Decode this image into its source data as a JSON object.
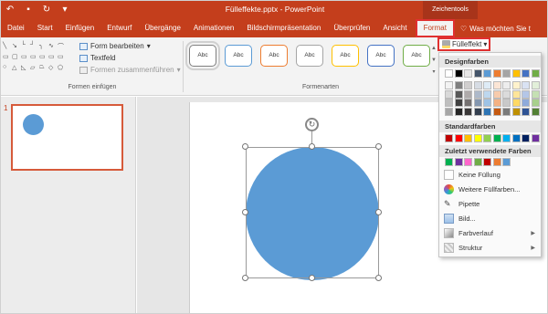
{
  "titlebar": {
    "doc_title": "Fülleffekte.pptx - PowerPoint",
    "context_label": "Zeichentools",
    "qat_icons": [
      "undo-icon",
      "save-icon",
      "refresh-icon",
      "customize-icon"
    ]
  },
  "tabs": [
    "Datei",
    "Start",
    "Einfügen",
    "Entwurf",
    "Übergänge",
    "Animationen",
    "Bildschirmpräsentation",
    "Überprüfen",
    "Ansicht",
    "Format"
  ],
  "tell_me": "Was möchten Sie t",
  "ribbon": {
    "edit_shape": "Form bearbeiten",
    "textbox": "Textfeld",
    "merge_shapes": "Formen zusammenführen",
    "group_insert_label": "Formen einfügen",
    "group_styles_label": "Formenarten",
    "style_label": "Abc",
    "style_colors": [
      "#7f7f7f",
      "#5b9bd5",
      "#ed7d31",
      "#a5a5a5",
      "#ffc000",
      "#4472c4",
      "#70ad47"
    ]
  },
  "fill_button": "Fülleffekt",
  "dropdown": {
    "theme_header": "Designfarben",
    "standard_header": "Standardfarben",
    "recent_header": "Zuletzt verwendete Farben",
    "theme_top": [
      "#ffffff",
      "#000000",
      "#e7e6e6",
      "#44546a",
      "#5b9bd5",
      "#ed7d31",
      "#a5a5a5",
      "#ffc000",
      "#4472c4",
      "#70ad47"
    ],
    "theme_shades": [
      [
        "#f2f2f2",
        "#d9d9d9",
        "#bfbfbf",
        "#a6a6a6"
      ],
      [
        "#7f7f7f",
        "#595959",
        "#404040",
        "#262626"
      ],
      [
        "#d0cece",
        "#aeaaaa",
        "#757171",
        "#3a3838"
      ],
      [
        "#d6dce4",
        "#adb9ca",
        "#8497b0",
        "#333f4f"
      ],
      [
        "#deebf6",
        "#bdd7ee",
        "#9dc3e6",
        "#2e75b5"
      ],
      [
        "#fbe5d5",
        "#f7cbac",
        "#f4b183",
        "#c55a11"
      ],
      [
        "#ededed",
        "#dbdbdb",
        "#c9c9c9",
        "#7b7b7b"
      ],
      [
        "#fff2cc",
        "#fee599",
        "#ffd965",
        "#bf9000"
      ],
      [
        "#d9e2f3",
        "#b4c6e7",
        "#8eaadb",
        "#2f5496"
      ],
      [
        "#e2efd9",
        "#c5e0b3",
        "#a8d08d",
        "#538135"
      ]
    ],
    "standard": [
      "#c00000",
      "#ff0000",
      "#ffc000",
      "#ffff00",
      "#92d050",
      "#00b050",
      "#00b0f0",
      "#0070c0",
      "#002060",
      "#7030a0"
    ],
    "recent": [
      "#00b050",
      "#7030a0",
      "#ff66cc",
      "#70ad47",
      "#c00000",
      "#ed7d31",
      "#5b9bd5"
    ],
    "items": [
      "Keine Füllung",
      "Weitere Füllfarben...",
      "Pipette",
      "Bild...",
      "Farbverlauf",
      "Struktur"
    ]
  },
  "slide_panel": {
    "slide_number": "1"
  },
  "colors": {
    "accent": "#c43e1c",
    "shape_fill": "#5b9bd5",
    "highlight": "#e03030"
  }
}
